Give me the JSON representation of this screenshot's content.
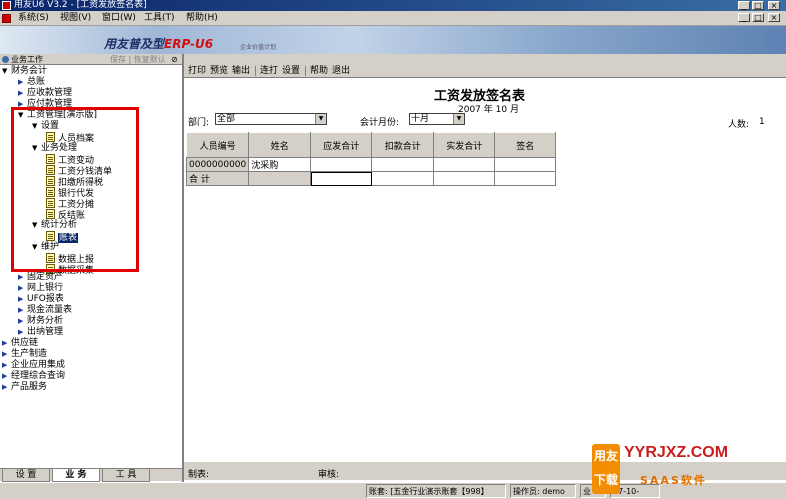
{
  "window": {
    "title": "用友U6 V3.2 - [工资发放签名表]",
    "controls": [
      "_",
      "□",
      "×"
    ],
    "mdi_controls": [
      "_",
      "□",
      "×"
    ]
  },
  "menu": [
    "系统(S)",
    "视图(V)",
    "窗口(W)",
    "工具(T)",
    "帮助(H)"
  ],
  "banner": {
    "logo_main": "用友普及型",
    "logo_erp": "ERP-U6",
    "logo_sub": "企业价值计划"
  },
  "left_panel": {
    "header": "业务工作",
    "header_links": "保存 | 恢复默认",
    "pin": "⊘",
    "tree": [
      {
        "label": "财务会计",
        "expanded": true
      },
      {
        "label": "总账",
        "expanded": false
      },
      {
        "label": "应收款管理",
        "expanded": false
      },
      {
        "label": "应付款管理",
        "expanded": false
      },
      {
        "label": "工资管理[演示版]",
        "expanded": true
      },
      {
        "label": "设置",
        "expanded": true
      },
      {
        "label": "人员档案"
      },
      {
        "label": "业务处理",
        "expanded": true
      },
      {
        "label": "工资变动"
      },
      {
        "label": "工资分钱清单"
      },
      {
        "label": "扣缴所得税"
      },
      {
        "label": "银行代发"
      },
      {
        "label": "工资分摊"
      },
      {
        "label": "反结账"
      },
      {
        "label": "统计分析",
        "expanded": true
      },
      {
        "label": "账表",
        "selected": true
      },
      {
        "label": "维护",
        "expanded": true
      },
      {
        "label": "数据上报"
      },
      {
        "label": "数据采集"
      },
      {
        "label": "固定资产",
        "expanded": false
      },
      {
        "label": "网上银行",
        "expanded": false
      },
      {
        "label": "UFO报表",
        "expanded": false
      },
      {
        "label": "现金流量表",
        "expanded": false
      },
      {
        "label": "财务分析",
        "expanded": false
      },
      {
        "label": "出纳管理",
        "expanded": false
      },
      {
        "label": "供应链",
        "expanded": false
      },
      {
        "label": "生产制造",
        "expanded": false
      },
      {
        "label": "企业应用集成",
        "expanded": false
      },
      {
        "label": "经理综合查询",
        "expanded": false
      },
      {
        "label": "产品服务",
        "expanded": false
      }
    ],
    "tabs": [
      "设 置",
      "业 务",
      "工 具"
    ]
  },
  "toolbar": [
    "打印",
    "预览",
    "输出",
    "连打",
    "设置",
    "帮助",
    "退出"
  ],
  "report": {
    "title": "工资发放签名表",
    "date": "2007 年 10 月",
    "dept_label": "部门:",
    "dept_value": "全部",
    "month_label": "会计月份:",
    "month_value": "十月",
    "count_label": "人数:",
    "count_value": "1",
    "columns": [
      "人员编号",
      "姓名",
      "应发合计",
      "扣款合计",
      "实发合计",
      "签名"
    ],
    "rows": [
      [
        "0000000000",
        "沈采购",
        "",
        "",
        "",
        ""
      ],
      [
        "合 计",
        "",
        "",
        "",
        "",
        ""
      ]
    ],
    "footer_maker": "制表:",
    "footer_audit": "审核:"
  },
  "status_bar": {
    "account": "账套: [五金行业演示账套【998】",
    "operator": "操作员: demo",
    "business": "业",
    "date": "07-10-"
  },
  "watermark": {
    "badge": "用友下载",
    "url": "YYRJXZ.COM",
    "sub": "SAAS软件"
  }
}
